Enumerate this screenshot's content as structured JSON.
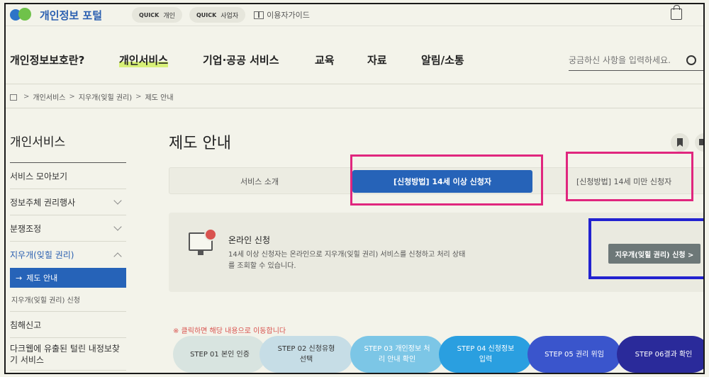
{
  "header": {
    "logo_text": "개인정보 포털",
    "quick_personal": {
      "tag": "QUICK",
      "label": "개인"
    },
    "quick_business": {
      "tag": "QUICK",
      "label": "사업자"
    },
    "guide_label": "이용자가이드"
  },
  "nav": {
    "brand": "개인정보보호란?",
    "items": [
      "개인서비스",
      "기업·공공 서비스",
      "교육",
      "자료",
      "알림/소통"
    ],
    "search_placeholder": "궁금하신 사항을 입력하세요."
  },
  "breadcrumb": [
    "개인서비스",
    "지우개(잊힐 권리)",
    "제도 안내"
  ],
  "sidebar": {
    "title": "개인서비스",
    "items": [
      "서비스 모아보기",
      "정보주체 권리행사",
      "분쟁조정",
      "지우개(잊힐 권리)"
    ],
    "sub_active": "제도 안내",
    "sub_item": "지우개(잊힐 권리) 신청",
    "items_after": [
      "침해신고",
      "다크웹에 유출된 털린 내정보찾기 서비스"
    ]
  },
  "content": {
    "title": "제도 안내",
    "tabs": [
      "서비스 소개",
      "[신청방법] 14세 이상 신청자",
      "[신청방법] 14세 미만 신청자"
    ],
    "panel": {
      "title": "온라인 신청",
      "desc": "14세 이상 신청자는 온라인으로 지우개(잊힐 권리) 서비스를 신청하고 처리 상태를 조회할 수 있습니다.",
      "button": "지우개(잊힐 권리) 신청 >"
    },
    "notice": "※ 클릭하면 해당 내용으로 이동합니다",
    "steps": [
      {
        "label": "STEP 01 본인 인증",
        "bg": "#d8e4e0",
        "fg": "#333333"
      },
      {
        "label": "STEP 02 신청유형 선택",
        "bg": "#c6dde6",
        "fg": "#333333"
      },
      {
        "label": "STEP 03 개인정보 처리 안내 확인",
        "bg": "#7cc6e6",
        "fg": "#ffffff"
      },
      {
        "label": "STEP 04 신청정보 입력",
        "bg": "#2a9fe0",
        "fg": "#ffffff"
      },
      {
        "label": "STEP 05 권리 위임",
        "bg": "#3a55cc",
        "fg": "#ffffff"
      },
      {
        "label": "STEP 06결과 확인",
        "bg": "#2a2a9a",
        "fg": "#ffffff"
      }
    ]
  }
}
